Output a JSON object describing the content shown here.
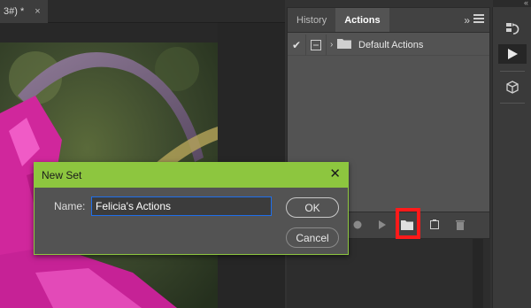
{
  "document": {
    "tab_label": "3#) *",
    "tab_close": "×"
  },
  "panel": {
    "tabs": [
      {
        "label": "History",
        "active": false
      },
      {
        "label": "Actions",
        "active": true
      }
    ],
    "expand_glyph": "»",
    "rows": [
      {
        "checked": true,
        "check_glyph": "✔",
        "chevron": "›",
        "label": "Default Actions",
        "icon": "folder-icon"
      }
    ],
    "footer_icons": [
      "record-icon",
      "play-icon",
      "new-set-folder-icon",
      "new-action-icon",
      "delete-icon"
    ],
    "highlighted_icon": "new-set-folder-icon",
    "highlight_color": "#ff1a1a"
  },
  "toolbar": {
    "collapse_glyph": "«",
    "buttons": [
      {
        "icon": "history-icon",
        "active": false
      },
      {
        "icon": "actions-play-icon",
        "active": true
      },
      {
        "icon": "3d-cube-icon",
        "active": false
      }
    ]
  },
  "dialog": {
    "title": "New Set",
    "close_glyph": "✕",
    "name_label": "Name:",
    "name_value": "Felicia's Actions",
    "ok_label": "OK",
    "cancel_label": "Cancel",
    "accent_color": "#8dc63f"
  }
}
